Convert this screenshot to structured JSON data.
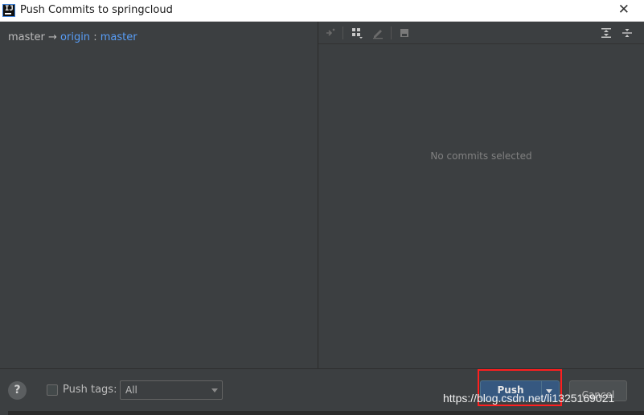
{
  "window": {
    "title": "Push Commits to springcloud",
    "app_icon": "intellij-icon",
    "close_icon": "close-icon"
  },
  "left": {
    "branch_local": "master",
    "arrow": "→",
    "remote": "origin",
    "separator": ":",
    "remote_branch": "master"
  },
  "toolbar": {
    "icons": [
      "merge-icon",
      "group-icon",
      "edit-icon",
      "save-icon",
      "expand-all-icon",
      "collapse-all-icon"
    ]
  },
  "right": {
    "empty_message": "No commits selected"
  },
  "bottom": {
    "help_label": "?",
    "push_tags_label": "Push tags:",
    "tags_value": "All",
    "push_label": "Push",
    "cancel_label": "Cancel",
    "watermark": "https://blog.csdn.net/li1325169021",
    "colors": {
      "accent": "#365880",
      "highlight": "#ff1f1f",
      "link": "#589df6"
    }
  }
}
